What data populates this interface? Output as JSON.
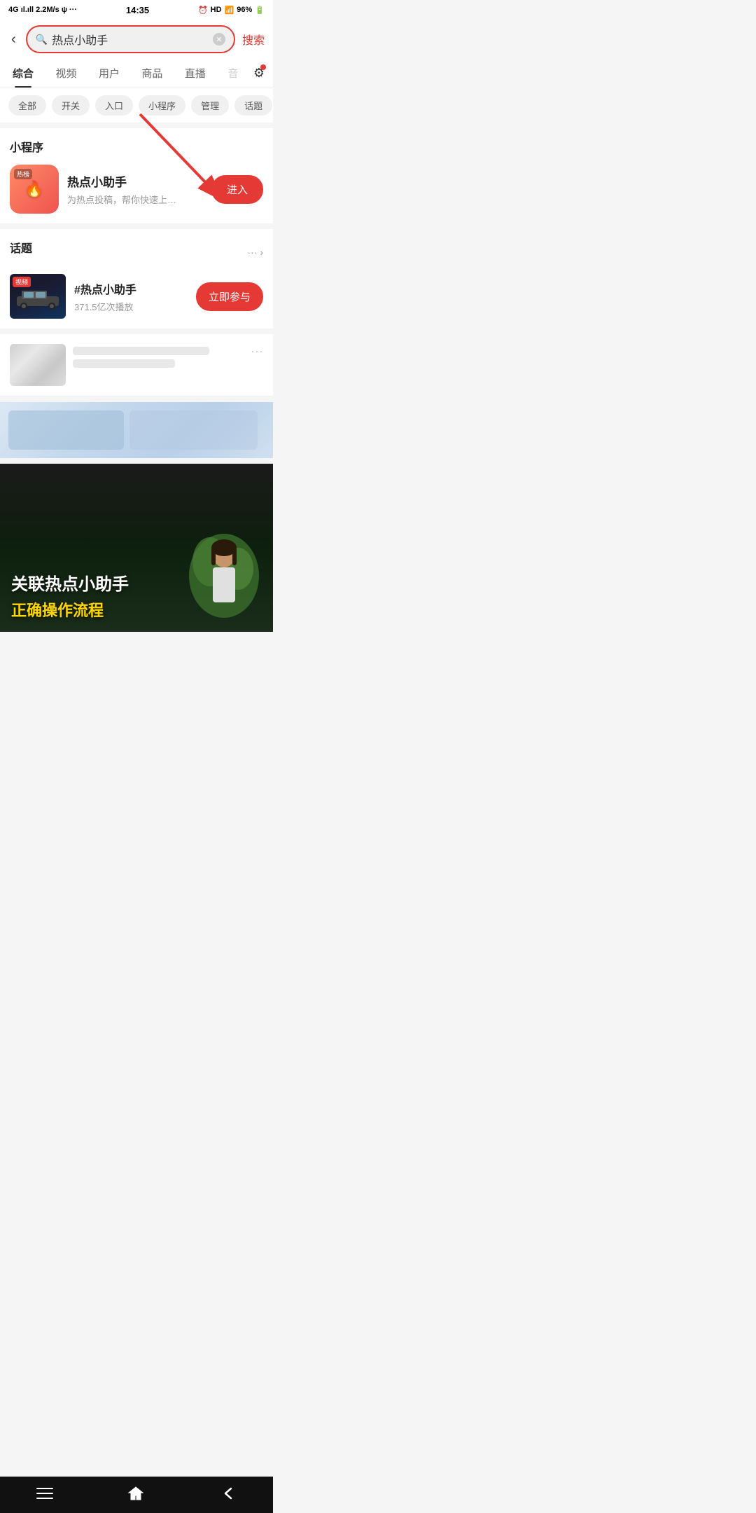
{
  "statusBar": {
    "signal": "4G ıl.ıll",
    "speed": "2.2M/s",
    "usb": "ψ",
    "dots": "···",
    "time": "14:35",
    "alarm": "⏰",
    "hd": "HD",
    "wifi": "WiFi",
    "battery": "96%",
    "bolt": "⚡"
  },
  "searchBar": {
    "backLabel": "‹",
    "searchPlaceholder": "热点小助手",
    "searchBtnLabel": "搜索"
  },
  "tabs": [
    {
      "label": "综合",
      "active": true
    },
    {
      "label": "视频",
      "active": false
    },
    {
      "label": "用户",
      "active": false
    },
    {
      "label": "商品",
      "active": false
    },
    {
      "label": "直播",
      "active": false
    },
    {
      "label": "音",
      "active": false,
      "gray": true
    }
  ],
  "filterTags": [
    "全部",
    "开关",
    "入口",
    "小程序",
    "管理",
    "话题"
  ],
  "miniProgram": {
    "sectionTitle": "小程序",
    "iconBadge": "热榜",
    "iconEmoji": "🔥",
    "name": "热点小助手",
    "desc": "为热点投稿，帮你快速上…",
    "enterBtn": "进入"
  },
  "topic": {
    "sectionTitle": "话题",
    "moreLabel": "···",
    "arrowLabel": "›",
    "name": "#热点小助手",
    "plays": "371.5亿次播放",
    "participateBtn": "立即参与",
    "imgBadge": "视频"
  },
  "contentCards": [
    {
      "moreBtn": "···"
    }
  ],
  "videoCard": {
    "titleLine1": "关联热点小助手",
    "titleLine2": "正确操作流程"
  },
  "bottomNav": {
    "menuLabel": "menu",
    "homeLabel": "home",
    "backLabel": "back"
  },
  "redArrow": {
    "label": "red arrow pointing to enter button"
  }
}
